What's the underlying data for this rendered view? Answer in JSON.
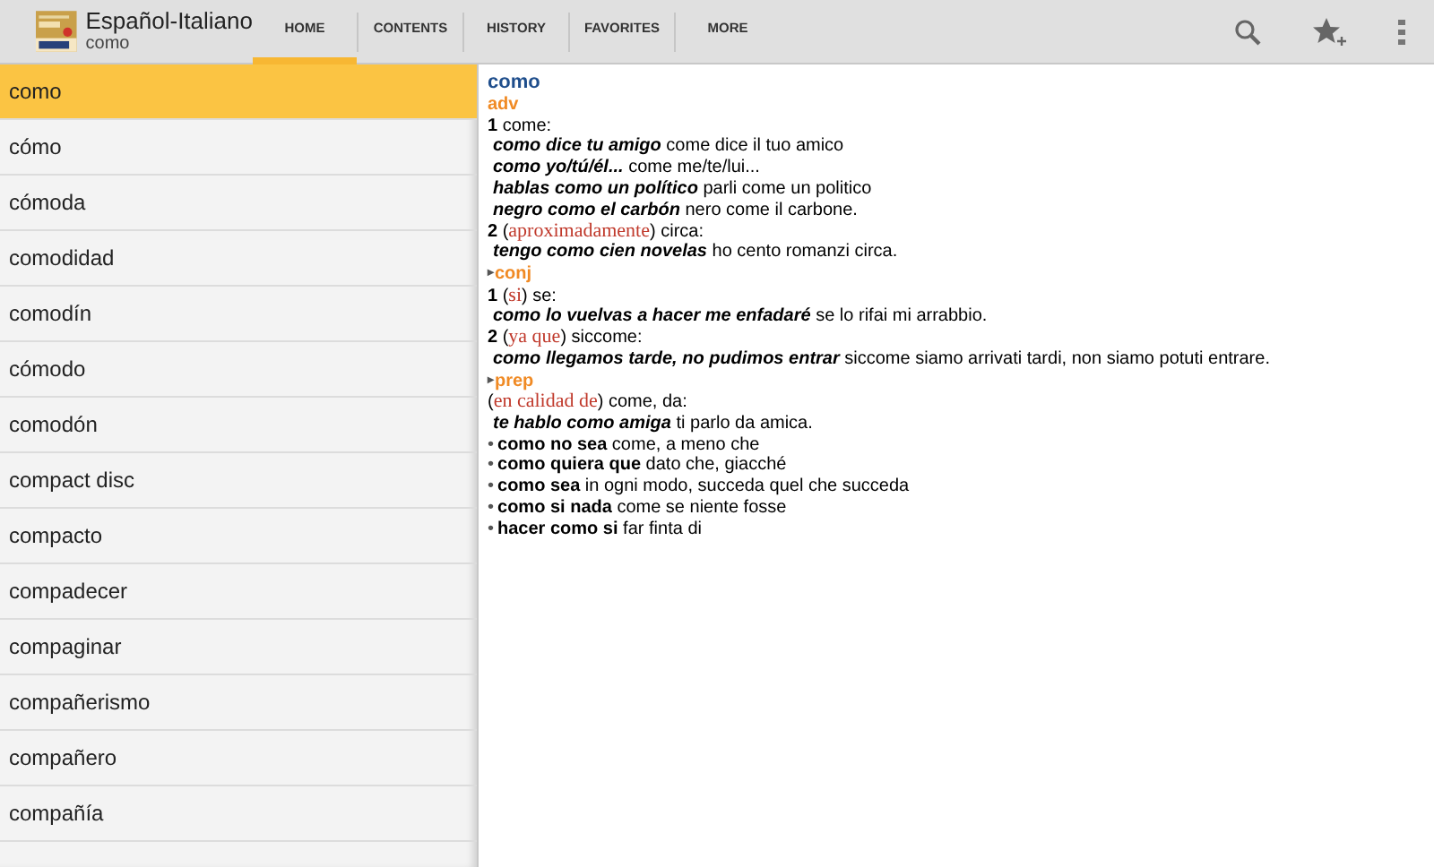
{
  "app_bar": {
    "title": "Español-Italiano",
    "subtitle": "como"
  },
  "tabs": [
    {
      "label": "HOME",
      "selected": true
    },
    {
      "label": "CONTENTS",
      "selected": false
    },
    {
      "label": "HISTORY",
      "selected": false
    },
    {
      "label": "FAVORITES",
      "selected": false
    },
    {
      "label": "MORE",
      "selected": false
    }
  ],
  "word_list": [
    {
      "word": "como",
      "selected": true
    },
    {
      "word": "cómo",
      "selected": false
    },
    {
      "word": "cómoda",
      "selected": false
    },
    {
      "word": "comodidad",
      "selected": false
    },
    {
      "word": "comodín",
      "selected": false
    },
    {
      "word": "cómodo",
      "selected": false
    },
    {
      "word": "comodón",
      "selected": false
    },
    {
      "word": "compact disc",
      "selected": false
    },
    {
      "word": "compacto",
      "selected": false
    },
    {
      "word": "compadecer",
      "selected": false
    },
    {
      "word": "compaginar",
      "selected": false
    },
    {
      "word": "compañerismo",
      "selected": false
    },
    {
      "word": "compañero",
      "selected": false
    },
    {
      "word": "compañía",
      "selected": false
    }
  ],
  "entry": [
    {
      "kind": "headword",
      "parts": [
        {
          "kind": "text",
          "text": "como"
        }
      ]
    },
    {
      "kind": "pos",
      "parts": [
        {
          "kind": "text",
          "text": "adv"
        }
      ]
    },
    {
      "kind": "sense",
      "parts": [
        {
          "kind": "number",
          "text": "1"
        },
        {
          "kind": "text",
          "text": " come:"
        }
      ]
    },
    {
      "kind": "example",
      "parts": [
        {
          "kind": "example",
          "text": "como dice tu amigo"
        },
        {
          "kind": "text",
          "text": " come dice il tuo amico"
        }
      ]
    },
    {
      "kind": "example",
      "parts": [
        {
          "kind": "example",
          "text": "como yo/tú/él..."
        },
        {
          "kind": "text",
          "text": " come me/te/lui..."
        }
      ]
    },
    {
      "kind": "example",
      "parts": [
        {
          "kind": "example",
          "text": "hablas como un político"
        },
        {
          "kind": "text",
          "text": " parli come un politico"
        }
      ]
    },
    {
      "kind": "example",
      "parts": [
        {
          "kind": "example",
          "text": "negro como el carbón"
        },
        {
          "kind": "text",
          "text": " nero come il carbone."
        }
      ]
    },
    {
      "kind": "sense",
      "parts": [
        {
          "kind": "number",
          "text": "2"
        },
        {
          "kind": "text",
          "text": " ("
        },
        {
          "kind": "gloss",
          "text": "aproximadamente"
        },
        {
          "kind": "text",
          "text": ") circa:"
        }
      ]
    },
    {
      "kind": "example",
      "parts": [
        {
          "kind": "example",
          "text": "tengo como cien novelas"
        },
        {
          "kind": "text",
          "text": " ho cento romanzi circa."
        }
      ]
    },
    {
      "kind": "pos",
      "marker": "▸",
      "parts": [
        {
          "kind": "text",
          "text": "conj"
        }
      ]
    },
    {
      "kind": "sense",
      "parts": [
        {
          "kind": "number",
          "text": "1"
        },
        {
          "kind": "text",
          "text": " ("
        },
        {
          "kind": "gloss",
          "text": "si"
        },
        {
          "kind": "text",
          "text": ") se:"
        }
      ]
    },
    {
      "kind": "example",
      "parts": [
        {
          "kind": "example",
          "text": "como lo vuelvas a hacer me enfadaré"
        },
        {
          "kind": "text",
          "text": " se lo rifai mi arrabbio."
        }
      ]
    },
    {
      "kind": "sense",
      "parts": [
        {
          "kind": "number",
          "text": "2"
        },
        {
          "kind": "text",
          "text": " ("
        },
        {
          "kind": "gloss",
          "text": "ya que"
        },
        {
          "kind": "text",
          "text": ") siccome:"
        }
      ]
    },
    {
      "kind": "example",
      "parts": [
        {
          "kind": "example",
          "text": "como llegamos tarde, no pudimos entrar"
        },
        {
          "kind": "text",
          "text": " siccome siamo arrivati tardi, non siamo potuti entrare."
        }
      ]
    },
    {
      "kind": "pos",
      "marker": "▸",
      "parts": [
        {
          "kind": "text",
          "text": "prep"
        }
      ]
    },
    {
      "kind": "sense",
      "parts": [
        {
          "kind": "text",
          "text": "("
        },
        {
          "kind": "gloss",
          "text": "en calidad de"
        },
        {
          "kind": "text",
          "text": ") come, da:"
        }
      ]
    },
    {
      "kind": "example",
      "parts": [
        {
          "kind": "example",
          "text": "te hablo como amiga"
        },
        {
          "kind": "text",
          "text": " ti parlo da amica."
        }
      ]
    },
    {
      "kind": "phrase",
      "marker": "•",
      "parts": [
        {
          "kind": "phrase",
          "text": "como no sea"
        },
        {
          "kind": "text",
          "text": " come, a meno che"
        }
      ]
    },
    {
      "kind": "phrase",
      "marker": "•",
      "parts": [
        {
          "kind": "phrase",
          "text": "como quiera que"
        },
        {
          "kind": "text",
          "text": " dato che, giacché"
        }
      ]
    },
    {
      "kind": "phrase",
      "marker": "•",
      "parts": [
        {
          "kind": "phrase",
          "text": "como sea"
        },
        {
          "kind": "text",
          "text": " in ogni modo, succeda quel che succeda"
        }
      ]
    },
    {
      "kind": "phrase",
      "marker": "•",
      "parts": [
        {
          "kind": "phrase",
          "text": "como si nada"
        },
        {
          "kind": "text",
          "text": " come se niente fosse"
        }
      ]
    },
    {
      "kind": "phrase",
      "marker": "•",
      "parts": [
        {
          "kind": "phrase",
          "text": "hacer como si"
        },
        {
          "kind": "text",
          "text": " far finta di"
        }
      ]
    }
  ]
}
